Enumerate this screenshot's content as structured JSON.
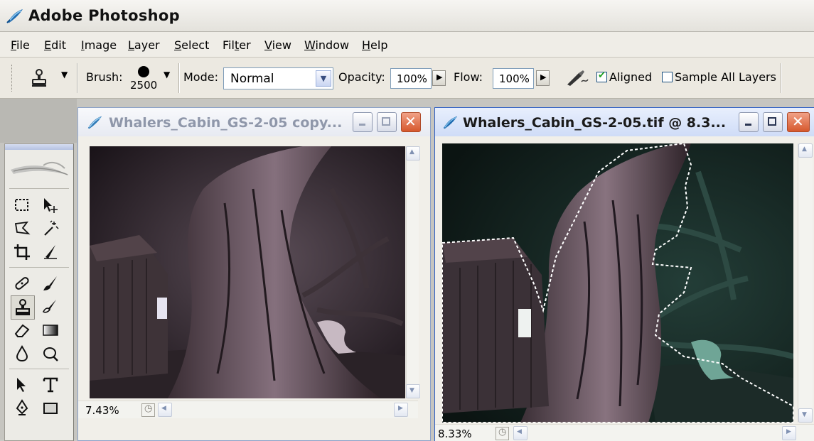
{
  "app": {
    "title": "Adobe Photoshop"
  },
  "menu": [
    {
      "name": "menu-file",
      "pre": "",
      "u": "F",
      "post": "ile"
    },
    {
      "name": "menu-edit",
      "pre": "",
      "u": "E",
      "post": "dit"
    },
    {
      "name": "menu-image",
      "pre": "",
      "u": "I",
      "post": "mage"
    },
    {
      "name": "menu-layer",
      "pre": "",
      "u": "L",
      "post": "ayer"
    },
    {
      "name": "menu-select",
      "pre": "",
      "u": "S",
      "post": "elect"
    },
    {
      "name": "menu-filter",
      "pre": "Fil",
      "u": "t",
      "post": "er"
    },
    {
      "name": "menu-view",
      "pre": "",
      "u": "V",
      "post": "iew"
    },
    {
      "name": "menu-window",
      "pre": "",
      "u": "W",
      "post": "indow"
    },
    {
      "name": "menu-help",
      "pre": "",
      "u": "H",
      "post": "elp"
    }
  ],
  "options": {
    "brush_label": "Brush:",
    "brush_size": "2500",
    "mode_label": "Mode:",
    "mode_value": "Normal",
    "opacity_label": "Opacity:",
    "opacity_value": "100%",
    "flow_label": "Flow:",
    "flow_value": "100%",
    "aligned_label": "Aligned",
    "aligned_checked": true,
    "sample_all_label": "Sample All Layers",
    "sample_all_checked": false
  },
  "documents": [
    {
      "title": "Whalers_Cabin_GS-2-05 copy...",
      "zoom": "7.43%"
    },
    {
      "title": "Whalers_Cabin_GS-2-05.tif @ 8.3...",
      "zoom": "8.33%"
    }
  ],
  "colors": {
    "doc_active_title_bg": "#dbe7fb",
    "doc_inactive_title_bg": "#eef0f6",
    "active_title_text": "#1a1a1a",
    "inactive_title_text": "#8f97aa",
    "selection": "#ffffff"
  }
}
